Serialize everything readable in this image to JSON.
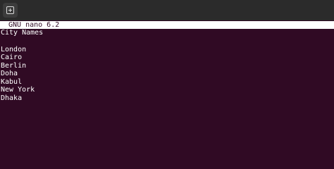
{
  "window": {
    "colors": {
      "terminal_background": "#300a24",
      "titlebar_background": "#2b2b2b",
      "header_background": "#ffffff",
      "text": "#ffffff"
    },
    "new_tab_icon": "new-tab-icon"
  },
  "nano": {
    "header_title": "GNU nano 6.2"
  },
  "editor": {
    "lines": [
      "City Names",
      "",
      "London",
      "Cairo",
      "Berlin",
      "Doha",
      "Kabul",
      "New York",
      "Dhaka"
    ]
  }
}
